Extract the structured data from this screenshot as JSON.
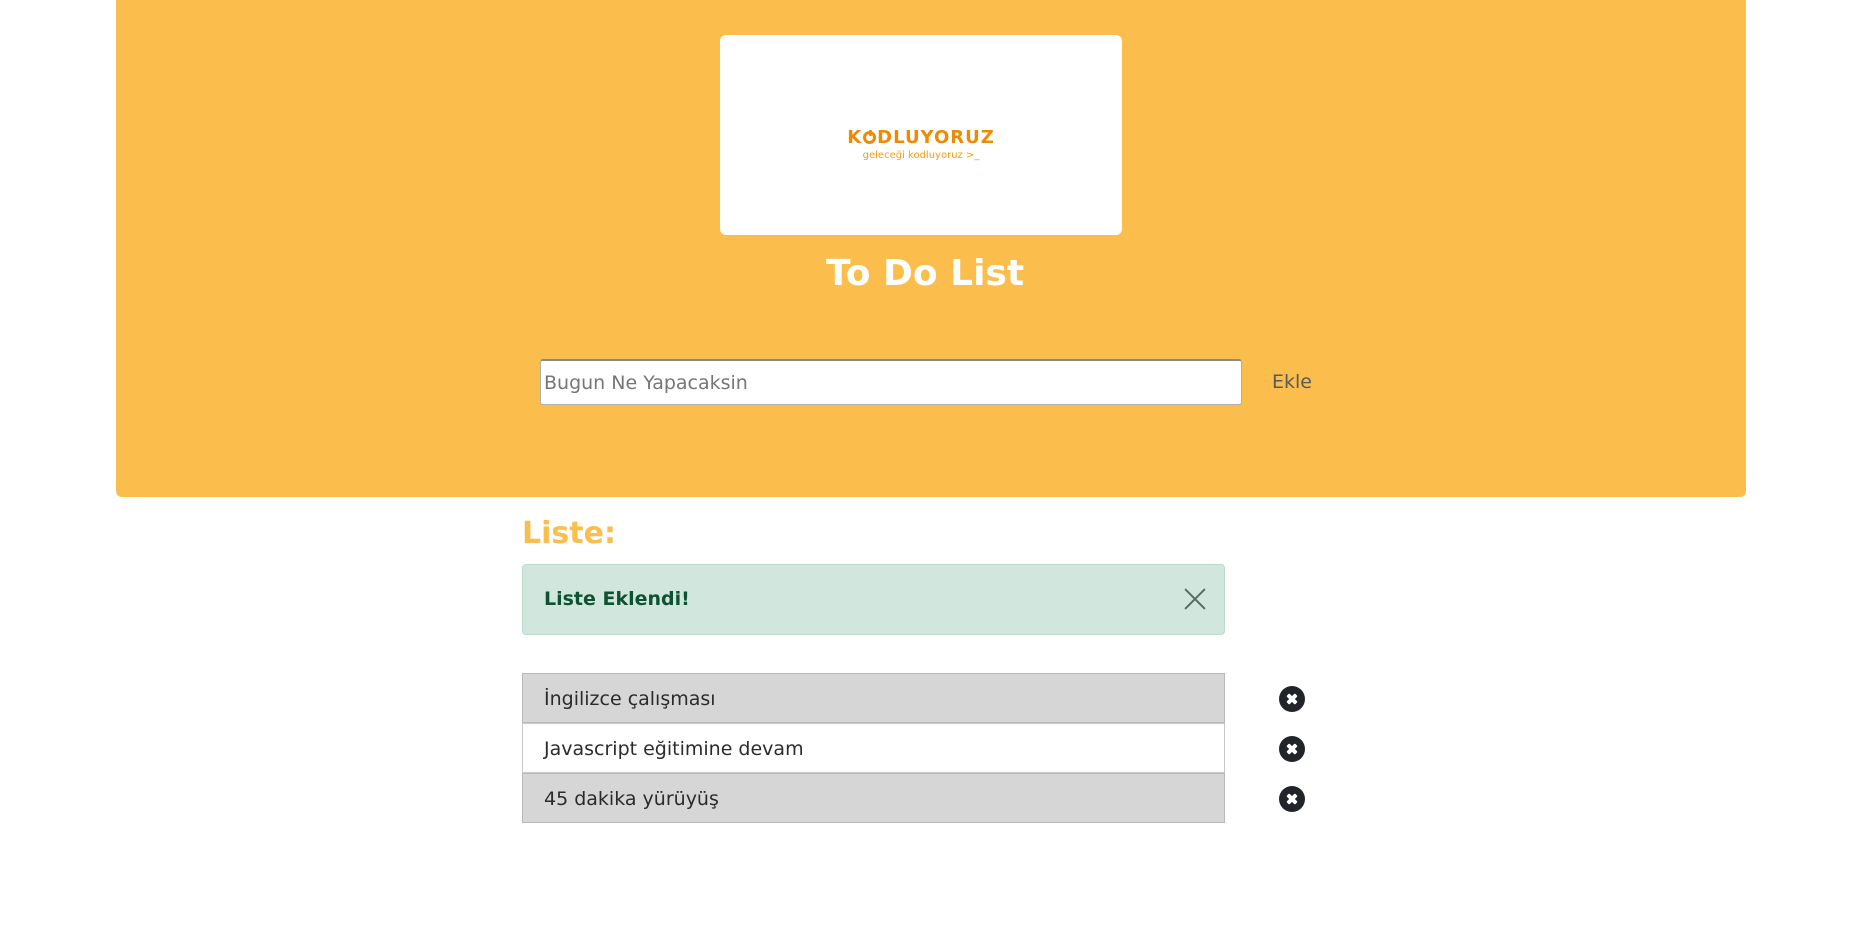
{
  "header": {
    "logo": {
      "brand_before": "K",
      "brand_after": "DLUYORUZ",
      "tagline": "geleceği kodluyoruz >_"
    },
    "title": "To Do List"
  },
  "form": {
    "input_placeholder": "Bugun Ne Yapacaksin",
    "input_value": "",
    "add_label": "Ekle"
  },
  "list": {
    "heading": "Liste:",
    "alert": "Liste Eklendi!",
    "items": [
      {
        "label": "İngilizce çalışması",
        "shaded": true
      },
      {
        "label": "Javascript eğitimine devam",
        "shaded": false
      },
      {
        "label": "45 dakika yürüyüş",
        "shaded": true
      }
    ]
  },
  "colors": {
    "accent": "#fbbd4c",
    "alert_bg": "#d1e7dd",
    "alert_text": "#0f5132",
    "logo_orange": "#f08a00",
    "row_shaded": "#d6d6d6"
  }
}
